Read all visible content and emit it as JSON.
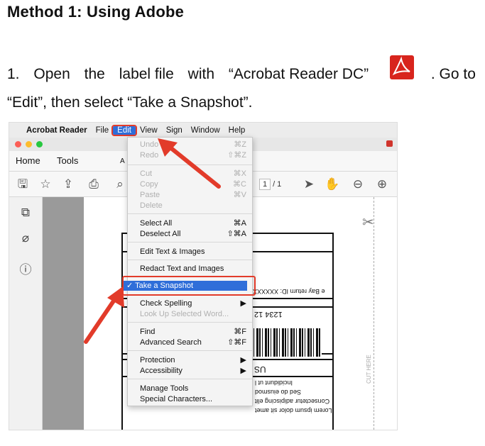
{
  "heading": "Method 1: Using Adobe",
  "para1": {
    "num": "1.",
    "w1": "Open",
    "w2": "the",
    "w3": "label file",
    "w4": "with",
    "w5": "“Acrobat Reader DC”",
    "w6": ". Go to"
  },
  "para2": "“Edit”, then select “Take a Snapshot”.",
  "icons": {
    "pdf": "acrobat-logo-icon"
  },
  "mac_menubar": {
    "apple": "",
    "items": [
      "Acrobat Reader",
      "File",
      "Edit",
      "View",
      "Sign",
      "Window",
      "Help"
    ]
  },
  "tabs": {
    "home": "Home",
    "tools": "Tools",
    "doc": "A"
  },
  "toolbar": {
    "page_current": "1",
    "page_total": "/ 1"
  },
  "edit_menu": {
    "undo": {
      "label": "Undo",
      "shortcut": "⌘Z"
    },
    "redo": {
      "label": "Redo",
      "shortcut": "⇧⌘Z"
    },
    "cut": {
      "label": "Cut",
      "shortcut": "⌘X"
    },
    "copy": {
      "label": "Copy",
      "shortcut": "⌘C"
    },
    "paste": {
      "label": "Paste",
      "shortcut": "⌘V"
    },
    "delete": {
      "label": "Delete"
    },
    "select_all": {
      "label": "Select All",
      "shortcut": "⌘A"
    },
    "deselect_all": {
      "label": "Deselect All",
      "shortcut": "⇧⌘A"
    },
    "edit_text": {
      "label": "Edit Text & Images"
    },
    "redact": {
      "label": "Redact Text and Images"
    },
    "snapshot": {
      "label": "✓ Take a Snapshot"
    },
    "spelling": {
      "label": "Check Spelling",
      "arrow": "▶"
    },
    "lookup": {
      "label": "Look Up Selected Word..."
    },
    "find": {
      "label": "Find",
      "shortcut": "⌘F"
    },
    "adv_search": {
      "label": "Advanced Search",
      "shortcut": "⇧⌘F"
    },
    "protection": {
      "label": "Protection",
      "arrow": "▶"
    },
    "accessibility": {
      "label": "Accessibility",
      "arrow": "▶"
    },
    "manage_tools": {
      "label": "Manage Tools"
    },
    "special_chars": {
      "label": "Special Characters..."
    }
  },
  "label_doc": {
    "ebay": "e Bay return ID: XXXXXX",
    "number": "1234 12",
    "us": "US",
    "lorem1": "Lorem ipsum dolor sit amet",
    "lorem2": "Consectetur adipiscing elit",
    "lorem3": "Sed do eiusmod",
    "lorem4": "Incididunt ut l",
    "cut_here": "CUT HERE"
  },
  "colors": {
    "highlight": "#e23b2a",
    "menu_select": "#2f6ed9",
    "acrobat_red": "#d8251d"
  }
}
